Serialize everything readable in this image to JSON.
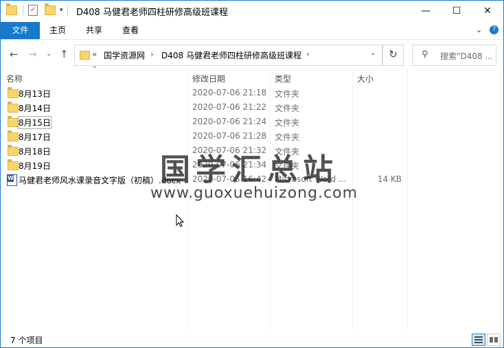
{
  "titlebar": {
    "title": "D408 马健君老师四柱研修高级班课程",
    "minimize": "—",
    "maximize": "☐",
    "close": "✕"
  },
  "ribbon": {
    "tabs": [
      "文件",
      "主页",
      "共享",
      "查看"
    ]
  },
  "nav": {
    "back": "←",
    "forward": "→",
    "recent": "⌄",
    "up": "↑",
    "breadcrumb": [
      "«",
      "国学资源网",
      "›",
      "D408 马健君老师四柱研修高级班课程",
      "›"
    ],
    "dropdown": "⌄",
    "refresh": "↻",
    "search_placeholder": "搜索\"D408 ..."
  },
  "columns": {
    "name": "名称",
    "date": "修改日期",
    "type": "类型",
    "size": "大小"
  },
  "files": [
    {
      "name": "8月13日",
      "date": "2020-07-06 21:18",
      "type": "文件夹",
      "size": "",
      "icon": "folder-icon"
    },
    {
      "name": "8月14日",
      "date": "2020-07-06 21:22",
      "type": "文件夹",
      "size": "",
      "icon": "folder-icon"
    },
    {
      "name": "8月15日",
      "date": "2020-07-06 21:24",
      "type": "文件夹",
      "size": "",
      "icon": "folder-icon"
    },
    {
      "name": "8月17日",
      "date": "2020-07-06 21:28",
      "type": "文件夹",
      "size": "",
      "icon": "folder-icon"
    },
    {
      "name": "8月18日",
      "date": "2020-07-06 21:32",
      "type": "文件夹",
      "size": "",
      "icon": "folder-icon"
    },
    {
      "name": "8月19日",
      "date": "2020-07-06 21:34",
      "type": "文件夹",
      "size": "",
      "icon": "folder-icon"
    },
    {
      "name": "马健君老师风水课录音文字版（初稿）.docx",
      "date": "2020-07-05 16:42",
      "type": "Microsoft Word ...",
      "size": "14 KB",
      "icon": "word-doc-icon"
    }
  ],
  "watermark": {
    "line1": "国学汇总站",
    "line2": "www.guoxuehuizong.com"
  },
  "status": {
    "count": "7 个项目"
  },
  "colors": {
    "accent": "#1979ca",
    "folder": "#f8d56b"
  }
}
